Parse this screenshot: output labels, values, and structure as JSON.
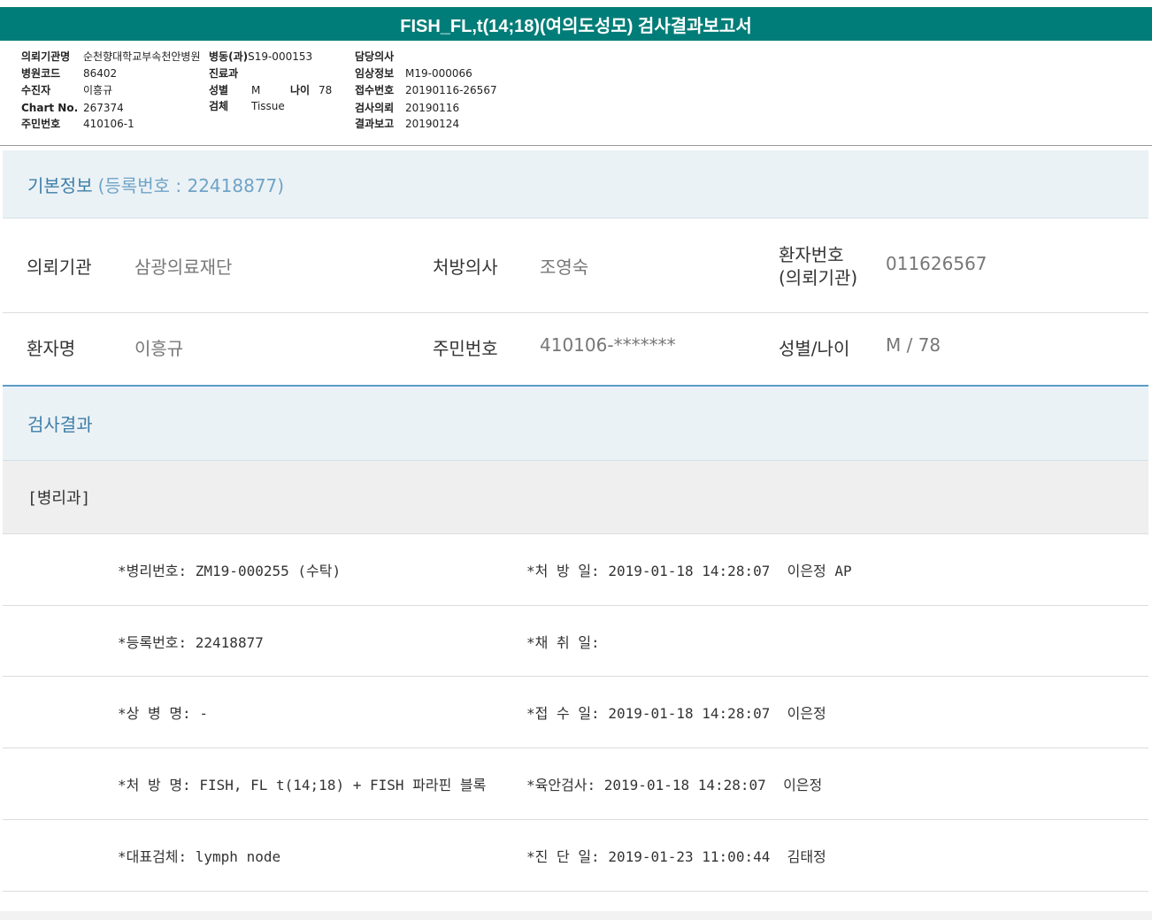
{
  "title": "FISH_FL,t(14;18)(여의도성모) 검사결과보고서",
  "header": {
    "col1": [
      {
        "label": "의뢰기관명",
        "value": "순천향대학교부속천안병원"
      },
      {
        "label": "병원코드",
        "value": "86402"
      },
      {
        "label": "수진자",
        "value": "이흥규"
      },
      {
        "label": "Chart No.",
        "value": "267374"
      },
      {
        "label": "주민번호",
        "value": "410106-1"
      }
    ],
    "col2": [
      {
        "label": "병동(과)",
        "value": "S19-000153"
      },
      {
        "label": "진료과",
        "value": ""
      },
      {
        "label": "성별",
        "value": "M"
      },
      {
        "label": "검체",
        "value": "Tissue"
      }
    ],
    "age": {
      "label": "나이",
      "value": "78"
    },
    "col3": [
      {
        "label": "담당의사",
        "value": ""
      },
      {
        "label": "임상정보",
        "value": "M19-000066"
      },
      {
        "label": "접수번호",
        "value": "20190116-26567"
      },
      {
        "label": "검사의뢰",
        "value": "20190116"
      },
      {
        "label": "결과보고",
        "value": "20190124"
      }
    ]
  },
  "basic": {
    "heading": "기본정보",
    "reg": "(등록번호 : 22418877)",
    "row1": {
      "inst_label": "의뢰기관",
      "inst_value": "삼광의료재단",
      "doc_label": "처방의사",
      "doc_value": "조영숙",
      "pid_label_1": "환자번호",
      "pid_label_2": "(의뢰기관)",
      "pid_value": "011626567"
    },
    "row2": {
      "name_label": "환자명",
      "name_value": "이흥규",
      "rrn_label": "주민번호",
      "rrn_value": "410106-*******",
      "sex_label": "성별/나이",
      "sex_value": "M / 78"
    }
  },
  "results": {
    "heading": "검사결과",
    "dept": "[병리과]",
    "rows": [
      {
        "left": "*병리번호: ZM19-000255 (수탁)",
        "right": "*처 방 일: 2019-01-18 14:28:07  이은정 AP"
      },
      {
        "left": "*등록번호: 22418877",
        "right": "*채 취 일:"
      },
      {
        "left": "*상 병 명: -",
        "right": "*접 수 일: 2019-01-18 14:28:07  이은정"
      },
      {
        "left": "*처 방 명: FISH, FL t(14;18) + FISH 파라핀 블록",
        "right": "*육안검사: 2019-01-18 14:28:07  이은정"
      },
      {
        "left": "*대표검체: lymph node",
        "right": "*진 단 일: 2019-01-23 11:00:44  김태정"
      }
    ]
  }
}
